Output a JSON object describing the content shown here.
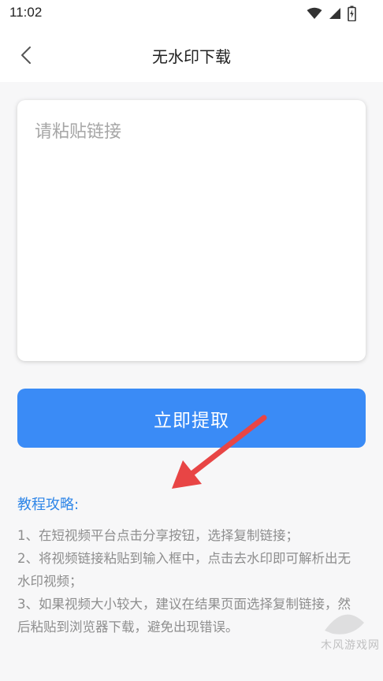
{
  "status_bar": {
    "time": "11:02",
    "icons": [
      "wifi-icon",
      "signal-icon",
      "battery-icon"
    ]
  },
  "header": {
    "title": "无水印下载",
    "back_icon": "chevron-left-icon"
  },
  "link_input": {
    "placeholder": "请粘贴链接",
    "value": ""
  },
  "extract_button": {
    "label": "立即提取",
    "color": "#3a8bf6"
  },
  "tutorial": {
    "title": "教程攻略:",
    "steps": [
      "1、在短视频平台点击分享按钮，选择复制链接；",
      "2、将视频链接粘贴到输入框中，点击去水印即可解析出无水印视频；",
      "3、如果视频大小较大，建议在结果页面选择复制链接，然后粘贴到浏览器下载，避免出现错误。"
    ]
  },
  "annotation": {
    "arrow_color": "#e84545"
  },
  "watermark": {
    "text": "木风游戏网"
  }
}
